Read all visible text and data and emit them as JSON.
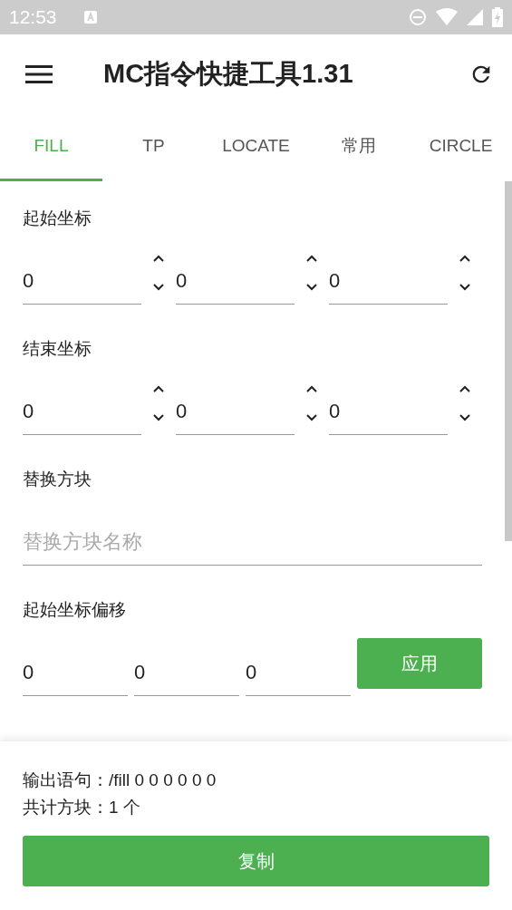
{
  "status_bar": {
    "time": "12:53"
  },
  "app_bar": {
    "title": "MC指令快捷工具1.31"
  },
  "tabs": [
    {
      "label": "FILL",
      "selected": true
    },
    {
      "label": "TP",
      "selected": false
    },
    {
      "label": "LOCATE",
      "selected": false
    },
    {
      "label": "常用",
      "selected": false
    },
    {
      "label": "CIRCLE",
      "selected": false
    }
  ],
  "sections": [
    {
      "kind": "spinner",
      "label": "起始坐标",
      "fields": [
        {
          "value": "0"
        },
        {
          "value": "0"
        },
        {
          "value": "0"
        }
      ]
    },
    {
      "kind": "spinner",
      "label": "结束坐标",
      "fields": [
        {
          "value": "0"
        },
        {
          "value": "0"
        },
        {
          "value": "0"
        }
      ]
    },
    {
      "kind": "text",
      "label": "替换方块",
      "placeholder": "替换方块名称"
    },
    {
      "kind": "offset",
      "label": "起始坐标偏移",
      "fields": [
        {
          "value": "0"
        },
        {
          "value": "0"
        },
        {
          "value": "0"
        }
      ],
      "button": "应用"
    }
  ],
  "output": {
    "command": "输出语句：/fill 0 0 0 0 0 0",
    "count": "共计方块：1 个",
    "copy_button": "复制"
  }
}
